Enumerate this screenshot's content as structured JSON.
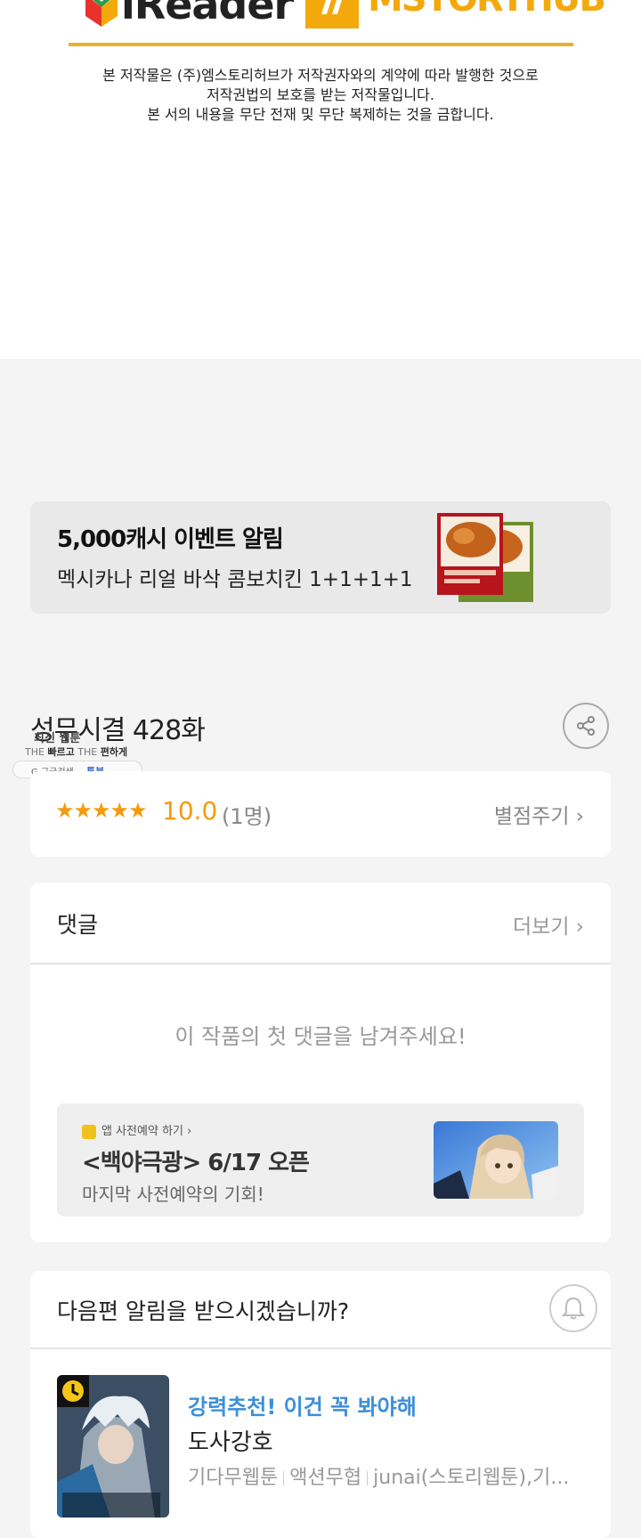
{
  "header": {
    "ireader_logo": "iReader",
    "mstory_logo": "MSTORYHUB",
    "copyright_lines": [
      "본 저작물은 (주)엠스토리허브가 저작권자와의 계약에 따라 발행한 것으로",
      "저작권법의 보호를 받는 저작물입니다.",
      "본 서의 내용을 무단 전재 및 무단 복제하는 것을 금합니다."
    ]
  },
  "banner": {
    "title": "5,000캐시 이벤트 알림",
    "subtitle": "멕시카나 리얼 바삭 콤보치킨 1+1+1+1"
  },
  "episode": {
    "title": "성무시결 428화"
  },
  "watermark": {
    "line1": "최신 웹툰",
    "line2_a": "THE ",
    "line2_b": "빠르고",
    "line2_c": " THE ",
    "line2_d": "편하게",
    "google": "G 구글검색",
    "toonbook": "툰북"
  },
  "rating": {
    "stars": "★★★★★",
    "score": "10.0",
    "count": "(1명)",
    "rate_button": "별점주기 ›"
  },
  "comments": {
    "heading": "댓글",
    "more_button": "더보기 ›",
    "empty_message": "이 작품의 첫 댓글을 남겨주세요!"
  },
  "ad": {
    "tag": "앱 사전예약 하기 ›",
    "title": "<백야극광> 6/17 오픈",
    "subtitle": "마지막 사전예약의 기회!"
  },
  "next": {
    "heading": "다음편 알림을 받으시겠습니까?",
    "recommend_tag": "강력추천! 이건 꼭 봐야해",
    "recommend_title": "도사강호",
    "meta": [
      "기다무웹툰",
      "액션무협",
      "junai(스토리웹툰),기..."
    ]
  },
  "colors": {
    "accent_orange": "#f39b0e",
    "brand_yellow": "#f3a90b",
    "link_blue": "#3b8fd9"
  }
}
